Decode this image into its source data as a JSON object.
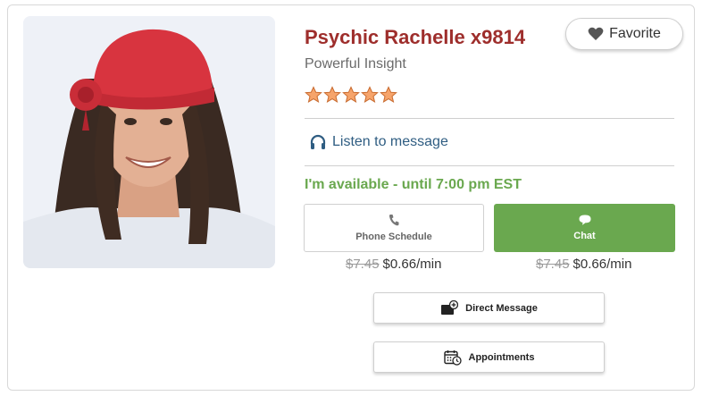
{
  "profile": {
    "name": "Psychic Rachelle x9814",
    "tagline": "Powerful Insight",
    "rating": 5,
    "photo_alt": "psychic-portrait"
  },
  "favorite": {
    "label": "Favorite",
    "icon": "heart-icon"
  },
  "listen": {
    "label": "Listen to message",
    "icon": "headphones-icon"
  },
  "availability": {
    "text": "I'm available - until 7:00 pm EST"
  },
  "phone": {
    "label": "Phone Schedule",
    "icon": "phone-icon",
    "old_price": "$7.45",
    "price": "$0.66/min"
  },
  "chat": {
    "label": "Chat",
    "icon": "chat-bubble-icon",
    "old_price": "$7.45",
    "price": "$0.66/min"
  },
  "direct_message": {
    "label": "Direct Message",
    "icon": "message-plus-icon"
  },
  "appointments": {
    "label": "Appointments",
    "icon": "calendar-clock-icon"
  },
  "colors": {
    "name": "#9e2e2c",
    "available": "#6aa84f",
    "chat_button": "#6aa84f",
    "link": "#2f5d82",
    "star": "#f0a060"
  }
}
